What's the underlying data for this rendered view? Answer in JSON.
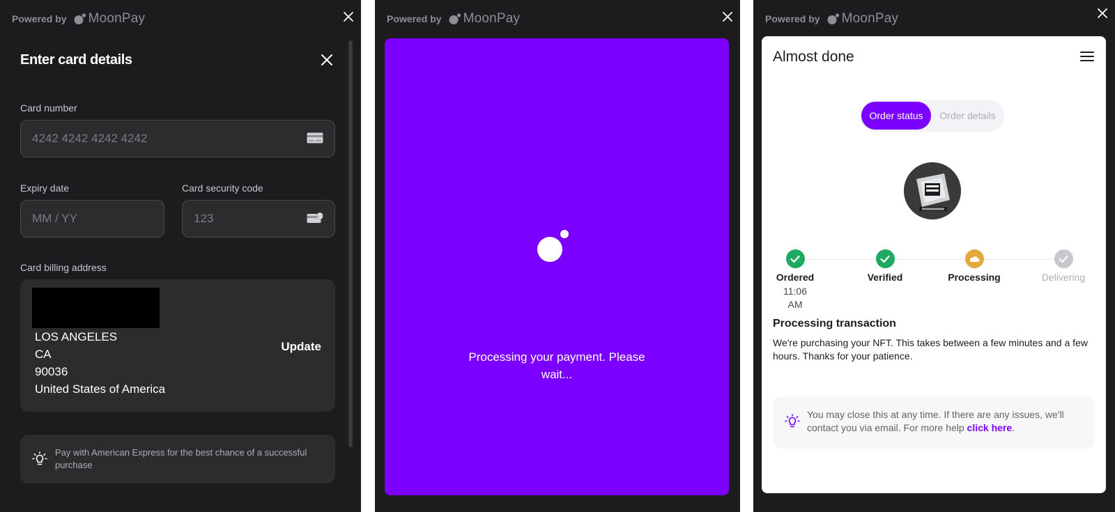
{
  "colors": {
    "brand_purple": "#7b00ff",
    "panel_bg": "#1c1c1e",
    "success_green": "#1faa61",
    "processing_yellow": "#e3a93d",
    "pending_gray": "#c7c7cc"
  },
  "branding": {
    "powered_by": "Powered by",
    "brand_name": "MoonPay"
  },
  "card_form": {
    "title": "Enter card details",
    "card_number": {
      "label": "Card number",
      "placeholder": "4242 4242 4242 4242",
      "icon": "credit-card-icon"
    },
    "expiry": {
      "label": "Expiry date",
      "placeholder": "MM / YY"
    },
    "cvc": {
      "label": "Card security code",
      "placeholder": "123",
      "icon": "card-cvc-icon"
    },
    "billing": {
      "label": "Card billing address",
      "lines": [
        "LOS ANGELES",
        "CA",
        "90036",
        "United States of America"
      ],
      "update_label": "Update"
    },
    "tip": {
      "icon": "lightbulb-icon",
      "text": "Pay with American Express for the best chance of a successful purchase"
    }
  },
  "processing": {
    "message": "Processing your payment. Please wait..."
  },
  "order": {
    "title": "Almost done",
    "tabs": [
      {
        "label": "Order status",
        "active": true
      },
      {
        "label": "Order details",
        "active": false
      }
    ],
    "steps": [
      {
        "label": "Ordered",
        "time": "11:06 AM",
        "state": "done"
      },
      {
        "label": "Verified",
        "time": "",
        "state": "done"
      },
      {
        "label": "Processing",
        "time": "",
        "state": "active"
      },
      {
        "label": "Delivering",
        "time": "",
        "state": "pending"
      }
    ],
    "section_title": "Processing transaction",
    "section_body": "We're purchasing your NFT. This takes between a few minutes and a few hours. Thanks for your patience.",
    "help": {
      "text": "You may close this at any time. If there are any issues, we'll contact you via email. For more help ",
      "link": "click here",
      "suffix": "."
    }
  }
}
